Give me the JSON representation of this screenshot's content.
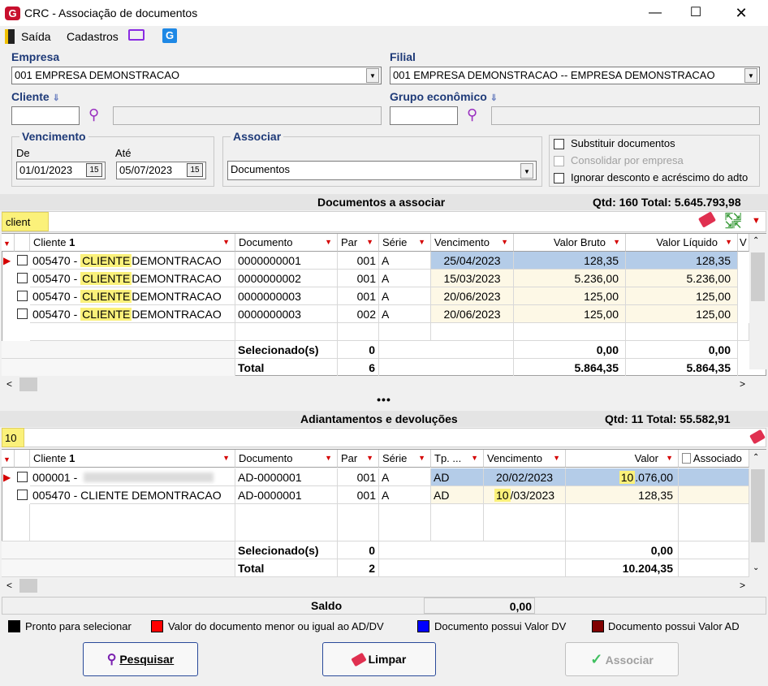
{
  "window": {
    "title": "CRC - Associação de documentos",
    "logo": "G"
  },
  "menu": {
    "saida": "Saída",
    "cadastros": "Cadastros"
  },
  "empresa": {
    "label": "Empresa",
    "value": "001 EMPRESA DEMONSTRACAO"
  },
  "filial": {
    "label": "Filial",
    "value": "001 EMPRESA DEMONSTRACAO -- EMPRESA DEMONSTRACAO"
  },
  "cliente": {
    "label": "Cliente"
  },
  "grupo": {
    "label": "Grupo econômico"
  },
  "vencimento": {
    "label": "Vencimento",
    "de_label": "De",
    "de": "01/01/2023",
    "ate_label": "Até",
    "ate": "05/07/2023"
  },
  "associar": {
    "label": "Associar",
    "value": "Documentos"
  },
  "options": {
    "substituir": "Substituir documentos",
    "consolidar": "Consolidar por empresa",
    "ignorar": "Ignorar desconto e acréscimo do adto"
  },
  "docs": {
    "title": "Documentos a associar",
    "summary": "Qtd: 160 Total: 5.645.793,98",
    "search": "client",
    "headers": {
      "cliente": "Cliente",
      "documento": "Documento",
      "par": "Par",
      "serie": "Série",
      "venc": "Vencimento",
      "bruto": "Valor Bruto",
      "liquido": "Valor Líquido",
      "v": "V"
    },
    "rows": [
      {
        "code": "005470 -",
        "name_hl": "CLIENTE",
        "name_rest": "DEMONTRACAO",
        "doc": "0000000001",
        "par": "001",
        "serie": "A",
        "venc": "25/04/2023",
        "bruto": "128,35",
        "liquido": "128,35"
      },
      {
        "code": "005470 -",
        "name_hl": "CLIENTE",
        "name_rest": "DEMONTRACAO",
        "doc": "0000000002",
        "par": "001",
        "serie": "A",
        "venc": "15/03/2023",
        "bruto": "5.236,00",
        "liquido": "5.236,00"
      },
      {
        "code": "005470 -",
        "name_hl": "CLIENTE",
        "name_rest": "DEMONTRACAO",
        "doc": "0000000003",
        "par": "001",
        "serie": "A",
        "venc": "20/06/2023",
        "bruto": "125,00",
        "liquido": "125,00"
      },
      {
        "code": "005470 -",
        "name_hl": "CLIENTE",
        "name_rest": "DEMONTRACAO",
        "doc": "0000000003",
        "par": "002",
        "serie": "A",
        "venc": "20/06/2023",
        "bruto": "125,00",
        "liquido": "125,00"
      }
    ],
    "selecionados": {
      "label": "Selecionado(s)",
      "qtd": "0",
      "bruto": "0,00",
      "liquido": "0,00"
    },
    "total": {
      "label": "Total",
      "qtd": "6",
      "bruto": "5.864,35",
      "liquido": "5.864,35"
    }
  },
  "divider": "•••",
  "adto": {
    "title": "Adiantamentos e devoluções",
    "summary": "Qtd: 11 Total: 55.582,91",
    "search": "10",
    "headers": {
      "cliente": "Cliente",
      "documento": "Documento",
      "par": "Par",
      "serie": "Série",
      "tp": "Tp. ...",
      "venc": "Vencimento",
      "valor": "Valor",
      "assoc": "Associado"
    },
    "rows": [
      {
        "cliente": "000001 -",
        "doc": "AD-0000001",
        "par": "001",
        "serie": "A",
        "tp": "AD",
        "venc": "20/02/2023",
        "valor_hl": "10",
        "valor_rest": ".076,00"
      },
      {
        "cliente": "005470 - CLIENTE DEMONTRACAO",
        "doc": "AD-0000001",
        "par": "001",
        "serie": "A",
        "tp": "AD",
        "venc_hl": "10",
        "venc_rest": "/03/2023",
        "valor": "128,35"
      }
    ],
    "selecionados": {
      "label": "Selecionado(s)",
      "qtd": "0",
      "valor": "0,00"
    },
    "total": {
      "label": "Total",
      "qtd": "2",
      "valor": "10.204,35"
    }
  },
  "saldo": {
    "label": "Saldo",
    "value": "0,00"
  },
  "legend": [
    {
      "color": "#000000",
      "text": "Pronto para selecionar"
    },
    {
      "color": "#ff0000",
      "text": "Valor do documento menor ou igual ao AD/DV"
    },
    {
      "color": "#0000ff",
      "text": "Documento possui Valor DV"
    },
    {
      "color": "#800000",
      "text": "Documento possui Valor AD"
    }
  ],
  "buttons": {
    "pesquisar": "Pesquisar",
    "limpar": "Limpar",
    "associar": "Associar"
  }
}
